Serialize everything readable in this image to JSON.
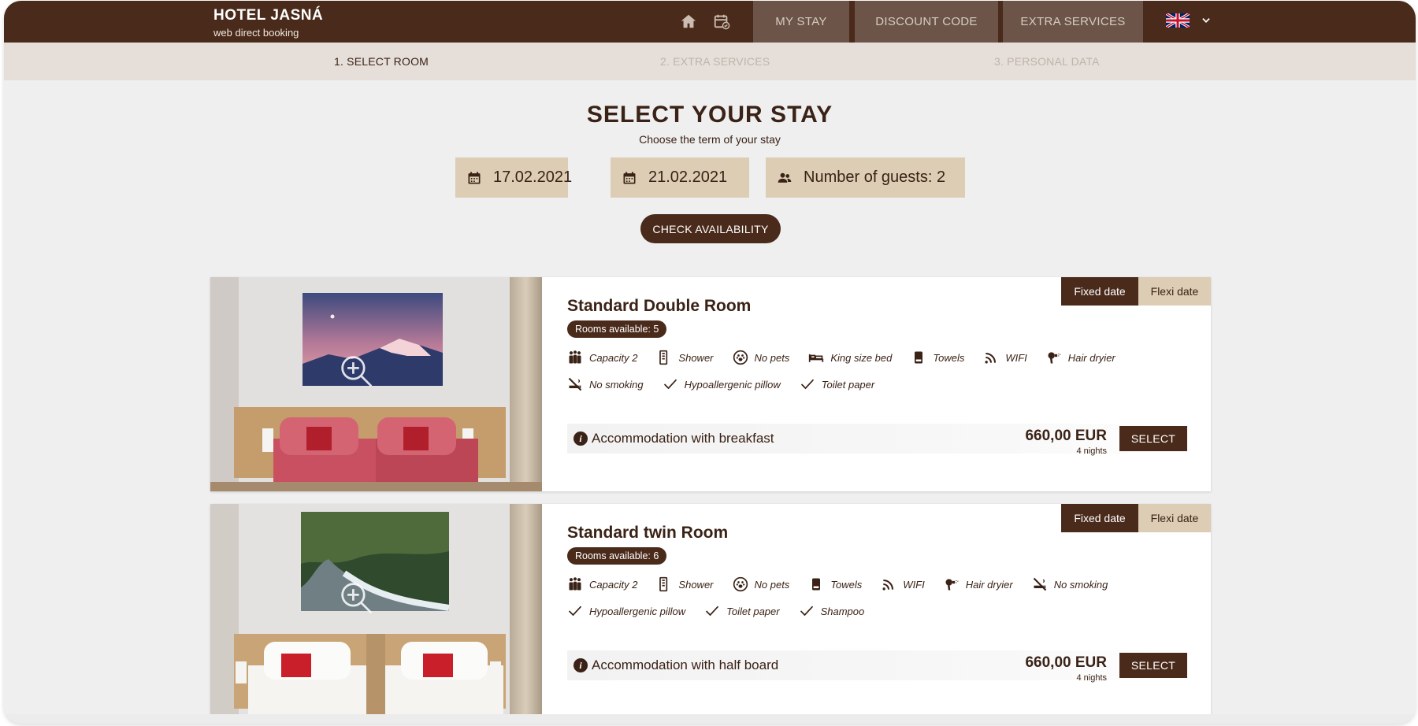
{
  "header": {
    "title": "HOTEL JASNÁ",
    "subtitle": "web direct booking",
    "icons": [
      "home-icon",
      "calendar-check-icon"
    ],
    "tabs": [
      {
        "label": "MY STAY"
      },
      {
        "label": "DISCOUNT CODE"
      },
      {
        "label": "EXTRA SERVICES"
      }
    ],
    "language": {
      "icon": "uk-flag-icon",
      "chevron": "chevron-down-icon"
    }
  },
  "steps": [
    {
      "label": "1. SELECT ROOM",
      "active": true
    },
    {
      "label": "2. EXTRA SERVICES",
      "active": false
    },
    {
      "label": "3. PERSONAL DATA",
      "active": false
    }
  ],
  "search": {
    "title": "SELECT YOUR STAY",
    "subtitle": "Choose the term of your stay",
    "check_in": "17.02.2021",
    "check_out": "21.02.2021",
    "guests": "Number of guests: 2",
    "button": "CHECK AVAILABILITY"
  },
  "rooms": [
    {
      "name": "Standard Double Room",
      "availability": "Rooms available: 5",
      "tabs": [
        "Fixed date",
        "Flexi date"
      ],
      "amenities": [
        {
          "label": "Capacity 2",
          "icon": "people-icon"
        },
        {
          "label": "Shower",
          "icon": "shower-icon"
        },
        {
          "label": "No pets",
          "icon": "paw-icon"
        },
        {
          "label": "King size bed",
          "icon": "bed-icon"
        },
        {
          "label": "Towels",
          "icon": "towel-icon"
        },
        {
          "label": "WIFI",
          "icon": "wifi-icon"
        },
        {
          "label": "Hair dryier",
          "icon": "hair-dryer-icon"
        },
        {
          "label": "No smoking",
          "icon": "no-smoking-icon"
        },
        {
          "label": "Hypoallergenic pillow",
          "icon": "check-icon"
        },
        {
          "label": "Toilet paper",
          "icon": "check-icon"
        }
      ],
      "board": "Accommodation with breakfast",
      "price": "660,00 EUR",
      "nights": "4 nights",
      "button": "SELECT"
    },
    {
      "name": "Standard twin Room",
      "availability": "Rooms available: 6",
      "tabs": [
        "Fixed date",
        "Flexi date"
      ],
      "amenities": [
        {
          "label": "Capacity 2",
          "icon": "people-icon"
        },
        {
          "label": "Shower",
          "icon": "shower-icon"
        },
        {
          "label": "No pets",
          "icon": "paw-icon"
        },
        {
          "label": "Towels",
          "icon": "towel-icon"
        },
        {
          "label": "WIFI",
          "icon": "wifi-icon"
        },
        {
          "label": "Hair dryier",
          "icon": "hair-dryer-icon"
        },
        {
          "label": "No smoking",
          "icon": "no-smoking-icon"
        },
        {
          "label": "Hypoallergenic pillow",
          "icon": "check-icon"
        },
        {
          "label": "Toilet paper",
          "icon": "check-icon"
        },
        {
          "label": "Shampoo",
          "icon": "check-icon"
        }
      ],
      "board": "Accommodation with half board",
      "price": "660,00 EUR",
      "nights": "4 nights",
      "button": "SELECT"
    }
  ],
  "colors": {
    "brand_dark": "#4a2a1a",
    "tab_bg": "#6c5548",
    "steps_bg": "#e6dfd9",
    "field_bg": "#dccdb4",
    "page_bg": "#efefef"
  }
}
